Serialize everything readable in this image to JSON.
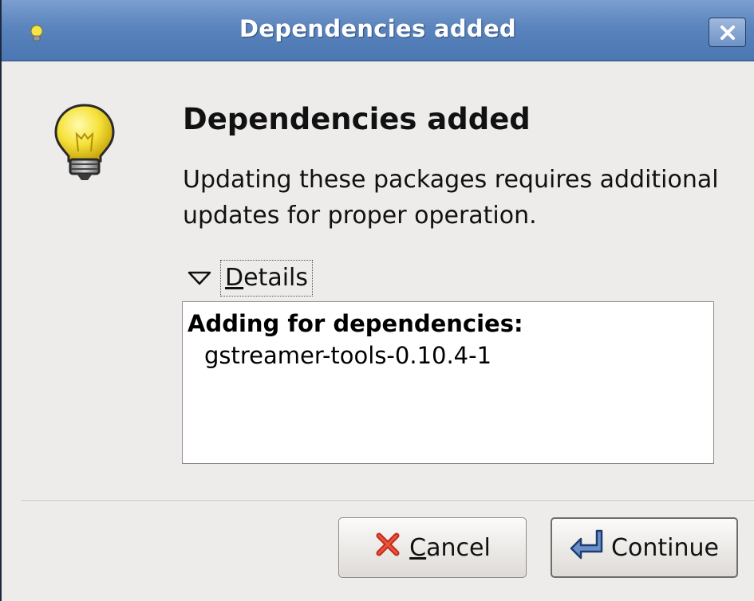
{
  "window": {
    "title": "Dependencies added",
    "close_icon": "close-icon"
  },
  "dialog": {
    "icon": "lightbulb-icon",
    "heading": "Dependencies added",
    "message": "Updating these packages requires additional updates for proper operation."
  },
  "details": {
    "expander_label_mnemonic": "D",
    "expander_label_rest": "etails",
    "expanded": true,
    "header": "Adding for dependencies:",
    "items": [
      "gstreamer-tools-0.10.4-1"
    ]
  },
  "buttons": {
    "cancel_mnemonic": "C",
    "cancel_rest": "ancel",
    "cancel_icon": "cancel-x-icon",
    "continue_label": "Continue",
    "continue_icon": "continue-arrow-icon"
  }
}
